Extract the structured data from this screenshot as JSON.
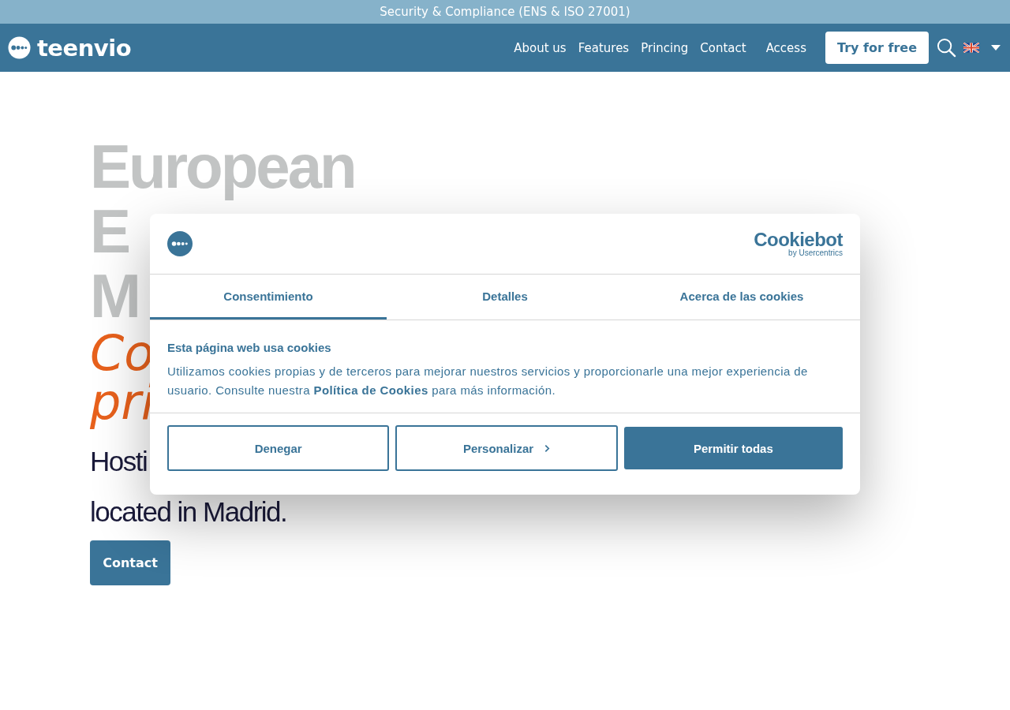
{
  "top_banner": "Security & Compliance (ENS & ISO 27001)",
  "nav": {
    "logo": "teenvio",
    "links": [
      "About us",
      "Features",
      "Princing",
      "Contact",
      "Access"
    ],
    "cta": "Try for free"
  },
  "hero": {
    "title_lines": [
      "European",
      "E",
      "M"
    ],
    "subtitle_lines": [
      "Co",
      "pri"
    ],
    "body_lines": [
      "Hosti",
      "located in Madrid."
    ],
    "button": "Contact"
  },
  "cookie_dialog": {
    "brand": "Cookiebot",
    "brand_sub": "by Usercentrics",
    "tabs": [
      {
        "label": "Consentimiento",
        "selected": true
      },
      {
        "label": "Detalles",
        "selected": false
      },
      {
        "label": "Acerca de las cookies",
        "selected": false
      }
    ],
    "heading": "Esta página web usa cookies",
    "text": "Utilizamos cookies propias y de terceros para mejorar nuestros servicios y proporcionarle una mejor experiencia de usuario. Consulte nuestra **Política de Cookies** para más información.",
    "buttons": [
      {
        "label": "Denegar",
        "kind": "outline"
      },
      {
        "label": "Personalizar",
        "kind": "more"
      },
      {
        "label": "Permitir todas",
        "kind": "filled"
      }
    ]
  }
}
